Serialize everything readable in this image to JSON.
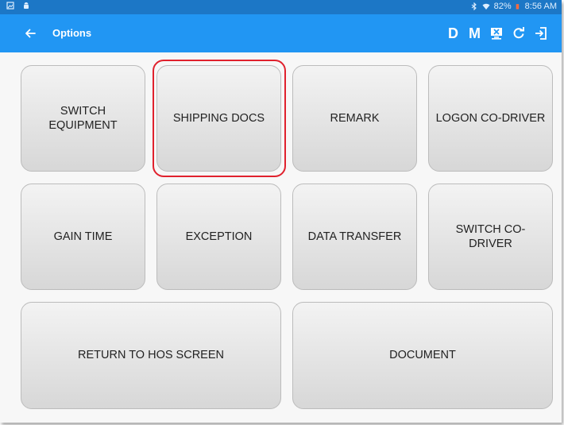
{
  "status_bar": {
    "battery": "82%",
    "time": "8:56 AM"
  },
  "app_bar": {
    "title": "Options",
    "actions": [
      "D",
      "M"
    ],
    "icons": [
      "back-arrow-icon",
      "monitor-icon",
      "refresh-icon",
      "logout-icon"
    ]
  },
  "options": {
    "switch_equipment": "SWITCH EQUIPMENT",
    "shipping_docs": "SHIPPING DOCS",
    "remark": "REMARK",
    "logon_co_driver": "LOGON CO-DRIVER",
    "gain_time": "GAIN TIME",
    "exception": "EXCEPTION",
    "data_transfer": "DATA TRANSFER",
    "switch_co_driver": "SWITCH CO-DRIVER",
    "return_to_hos": "RETURN TO HOS SCREEN",
    "document": "DOCUMENT"
  },
  "highlighted_option": "SHIPPING DOCS",
  "colors": {
    "status_bar": "#1c77c6",
    "app_bar": "#2196f3",
    "highlight": "#e0212d"
  }
}
